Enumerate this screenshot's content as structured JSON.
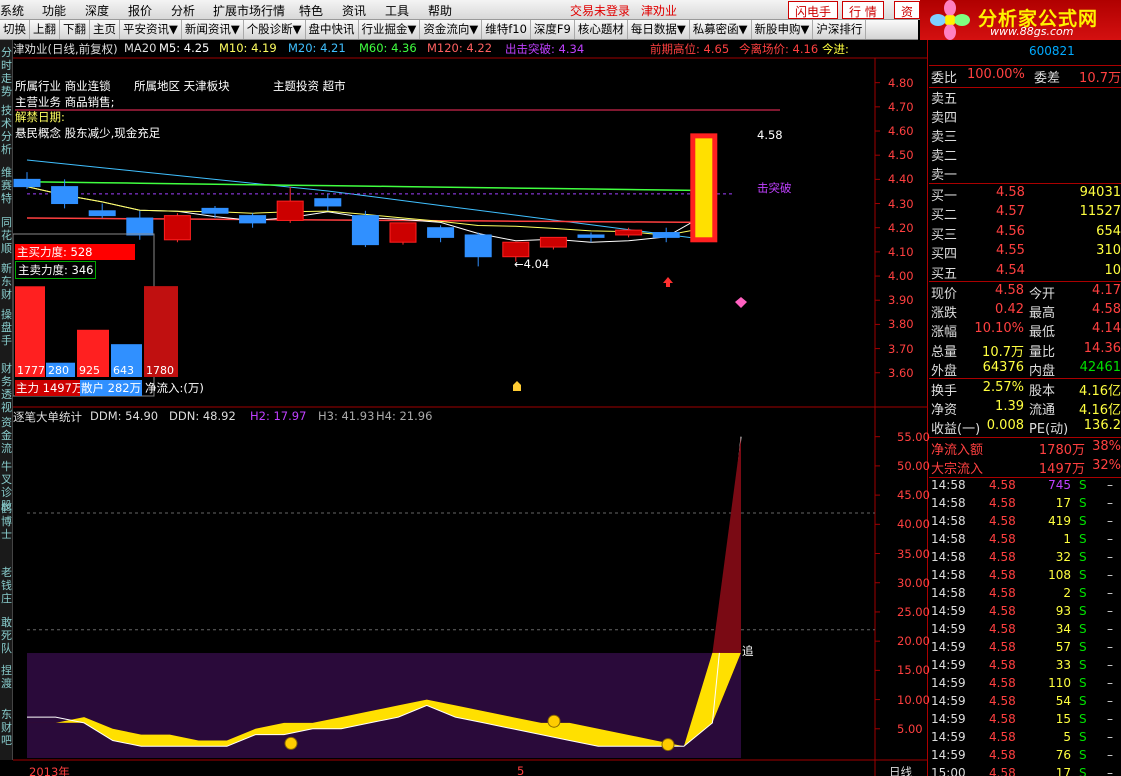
{
  "menu": [
    "系统",
    "功能",
    "深度",
    "报价",
    "分析",
    "扩展市场行情",
    "特色",
    "资讯",
    "工具",
    "帮助"
  ],
  "status": {
    "login": "交易未登录",
    "stock": "津劝业"
  },
  "top_buttons": [
    "闪电手",
    "行 情",
    "资"
  ],
  "toolbar": [
    "切换",
    "上翻",
    "下翻",
    "主页",
    "平安资讯▼",
    "新闻资讯▼",
    "个股诊断▼",
    "盘中快讯",
    "行业掘金▼",
    "资金流向▼",
    "维特f10",
    "深度F9",
    "核心题材",
    "每日数据▼",
    "私募密函▼",
    "新股申购▼",
    "沪深排行"
  ],
  "logo": {
    "title": "分析家公式网",
    "url": "www.88gs.com"
  },
  "left_tabs": [
    "分时走势",
    "技术分析",
    "维赛特",
    "同花顺",
    "新东财",
    "操盘手",
    "财务透视",
    "资金流",
    "牛叉诊股",
    "鹤博士",
    "老钱庄",
    "敢死队",
    "捏渡",
    "东财吧"
  ],
  "header": {
    "name": "津劝业(日线,前复权)",
    "ma": "MA20",
    "m5": "M5: 4.25",
    "m10": "M10: 4.19",
    "m20": "M20: 4.21",
    "m60": "M60: 4.36",
    "m120": "M120: 4.22",
    "breakout": "出击突破: 4.34",
    "prev_high": "前期高位: 4.65",
    "today_price": "今离场价: 4.16",
    "today_in": "今进:"
  },
  "info": {
    "industry": "所属行业 商业连锁",
    "region": "所属地区 天津板块",
    "theme": "主题投资 超市",
    "business": "主营业务 商品销售;",
    "unlock": "解禁日期:",
    "concept": "悬民概念 股东减少,现金充足"
  },
  "chart_data": [
    {
      "type": "candlestick",
      "title": "津劝业(日线,前复权)",
      "y_ticks": [
        4.8,
        4.7,
        4.6,
        4.5,
        4.4,
        4.3,
        4.2,
        4.1,
        4.0,
        3.9,
        3.8,
        3.7,
        3.6
      ],
      "ylim": [
        3.57,
        4.84
      ],
      "candles": [
        {
          "o": 4.4,
          "h": 4.43,
          "l": 4.36,
          "c": 4.37
        },
        {
          "o": 4.37,
          "h": 4.4,
          "l": 4.28,
          "c": 4.3
        },
        {
          "o": 4.27,
          "h": 4.3,
          "l": 4.24,
          "c": 4.25
        },
        {
          "o": 4.24,
          "h": 4.27,
          "l": 4.15,
          "c": 4.17
        },
        {
          "o": 4.15,
          "h": 4.26,
          "l": 4.14,
          "c": 4.25
        },
        {
          "o": 4.28,
          "h": 4.29,
          "l": 4.24,
          "c": 4.26
        },
        {
          "o": 4.25,
          "h": 4.26,
          "l": 4.2,
          "c": 4.22
        },
        {
          "o": 4.23,
          "h": 4.37,
          "l": 4.22,
          "c": 4.31
        },
        {
          "o": 4.32,
          "h": 4.34,
          "l": 4.27,
          "c": 4.29
        },
        {
          "o": 4.25,
          "h": 4.27,
          "l": 4.12,
          "c": 4.13
        },
        {
          "o": 4.14,
          "h": 4.22,
          "l": 4.13,
          "c": 4.22
        },
        {
          "o": 4.2,
          "h": 4.21,
          "l": 4.14,
          "c": 4.16
        },
        {
          "o": 4.17,
          "h": 4.18,
          "l": 4.04,
          "c": 4.08
        },
        {
          "o": 4.08,
          "h": 4.14,
          "l": 4.06,
          "c": 4.14
        },
        {
          "o": 4.12,
          "h": 4.16,
          "l": 4.11,
          "c": 4.16
        },
        {
          "o": 4.17,
          "h": 4.18,
          "l": 4.14,
          "c": 4.16
        },
        {
          "o": 4.17,
          "h": 4.2,
          "l": 4.16,
          "c": 4.19
        },
        {
          "o": 4.18,
          "h": 4.2,
          "l": 4.14,
          "c": 4.16
        },
        {
          "o": 4.15,
          "h": 4.58,
          "l": 4.15,
          "c": 4.58
        }
      ],
      "annotations": [
        {
          "text": "4.58"
        },
        {
          "text": "←4.04"
        },
        {
          "text": "击突破"
        }
      ]
    },
    {
      "type": "bar",
      "title": "主买力度 / 主卖力度",
      "labels": [
        "主买力度: 528",
        "主卖力度: 346"
      ],
      "bars": [
        {
          "value": 1777,
          "color": "#ff2020"
        },
        {
          "value": 280,
          "color": "#3090ff"
        },
        {
          "value": 925,
          "color": "#ff2020"
        },
        {
          "value": 643,
          "color": "#3090ff"
        },
        {
          "value": 1780,
          "color": "#c01010"
        }
      ],
      "footer": {
        "main": "主力 1497万",
        "retail": "散户 282万",
        "net": "净流入:(万)"
      }
    },
    {
      "type": "area",
      "title": "逐笔大单统计",
      "series_labels": [
        "DDM: 54.90",
        "DDN: 48.92",
        "H2: 17.97",
        "H3: 41.93",
        "H4: 21.96"
      ],
      "y_ticks": [
        55.0,
        50.0,
        45.0,
        40.0,
        35.0,
        30.0,
        25.0,
        20.0,
        15.0,
        10.0,
        5.0
      ],
      "ylim": [
        0,
        57
      ],
      "ddm": [
        7,
        7,
        6,
        3,
        2,
        2,
        2,
        2,
        4,
        4,
        5,
        5,
        6,
        7,
        9,
        7,
        6,
        5,
        4,
        3,
        2,
        2,
        2,
        2,
        6,
        55
      ],
      "ddn": [
        6,
        6,
        7,
        5,
        4,
        4,
        3,
        3,
        5,
        6,
        6,
        7,
        8,
        9,
        10,
        9,
        8,
        7,
        6,
        6,
        5,
        4,
        3,
        2,
        18,
        18
      ],
      "hlines": [
        17.97,
        41.93,
        21.96
      ],
      "tag": "追",
      "x_labels": [
        "2013年",
        "5",
        "日线"
      ]
    }
  ],
  "right_panel": {
    "code": "600821",
    "weibi": {
      "label": "委比",
      "value": "100.00%",
      "label2": "委差",
      "value2": "10.7万"
    },
    "sell": [
      {
        "label": "卖五"
      },
      {
        "label": "卖四"
      },
      {
        "label": "卖三"
      },
      {
        "label": "卖二"
      },
      {
        "label": "卖一"
      }
    ],
    "buy": [
      {
        "label": "买一",
        "price": "4.58",
        "vol": "94031"
      },
      {
        "label": "买二",
        "price": "4.57",
        "vol": "11527"
      },
      {
        "label": "买三",
        "price": "4.56",
        "vol": "654"
      },
      {
        "label": "买四",
        "price": "4.55",
        "vol": "310"
      },
      {
        "label": "买五",
        "price": "4.54",
        "vol": "10"
      }
    ],
    "quote": [
      {
        "l1": "现价",
        "v1": "4.58",
        "l2": "今开",
        "v2": "4.17"
      },
      {
        "l1": "涨跌",
        "v1": "0.42",
        "l2": "最高",
        "v2": "4.58"
      },
      {
        "l1": "涨幅",
        "v1": "10.10%",
        "l2": "最低",
        "v2": "4.14"
      },
      {
        "l1": "总量",
        "v1": "10.7万",
        "l2": "量比",
        "v2": "14.36"
      },
      {
        "l1": "外盘",
        "v1": "64376",
        "l2": "内盘",
        "v2": "42461"
      }
    ],
    "stats": [
      {
        "l1": "换手",
        "v1": "2.57%",
        "l2": "股本",
        "v2": "4.16亿"
      },
      {
        "l1": "净资",
        "v1": "1.39",
        "l2": "流通",
        "v2": "4.16亿"
      },
      {
        "l1": "收益(一)",
        "v1": "0.008",
        "l2": "PE(动)",
        "v2": "136.2"
      }
    ],
    "flows": [
      {
        "label": "净流入额",
        "value": "1780万",
        "pct": "38%"
      },
      {
        "label": "大宗流入",
        "value": "1497万",
        "pct": "32%"
      }
    ],
    "ticks": [
      {
        "t": "14:58",
        "p": "4.58",
        "v": "745",
        "s": "S"
      },
      {
        "t": "14:58",
        "p": "4.58",
        "v": "17",
        "s": "S"
      },
      {
        "t": "14:58",
        "p": "4.58",
        "v": "419",
        "s": "S"
      },
      {
        "t": "14:58",
        "p": "4.58",
        "v": "1",
        "s": "S"
      },
      {
        "t": "14:58",
        "p": "4.58",
        "v": "32",
        "s": "S"
      },
      {
        "t": "14:58",
        "p": "4.58",
        "v": "108",
        "s": "S"
      },
      {
        "t": "14:58",
        "p": "4.58",
        "v": "2",
        "s": "S"
      },
      {
        "t": "14:59",
        "p": "4.58",
        "v": "93",
        "s": "S"
      },
      {
        "t": "14:59",
        "p": "4.58",
        "v": "34",
        "s": "S"
      },
      {
        "t": "14:59",
        "p": "4.58",
        "v": "57",
        "s": "S"
      },
      {
        "t": "14:59",
        "p": "4.58",
        "v": "33",
        "s": "S"
      },
      {
        "t": "14:59",
        "p": "4.58",
        "v": "110",
        "s": "S"
      },
      {
        "t": "14:59",
        "p": "4.58",
        "v": "54",
        "s": "S"
      },
      {
        "t": "14:59",
        "p": "4.58",
        "v": "15",
        "s": "S"
      },
      {
        "t": "14:59",
        "p": "4.58",
        "v": "5",
        "s": "S"
      },
      {
        "t": "14:59",
        "p": "4.58",
        "v": "76",
        "s": "S"
      },
      {
        "t": "15:00",
        "p": "4.58",
        "v": "17",
        "s": "S"
      }
    ]
  },
  "colors": {
    "up": "#ff3030",
    "down": "#3090ff",
    "bg": "#000000",
    "frame": "#a00000",
    "yellow": "#ffff00",
    "green": "#00c000",
    "cyan": "#00e0e0"
  }
}
